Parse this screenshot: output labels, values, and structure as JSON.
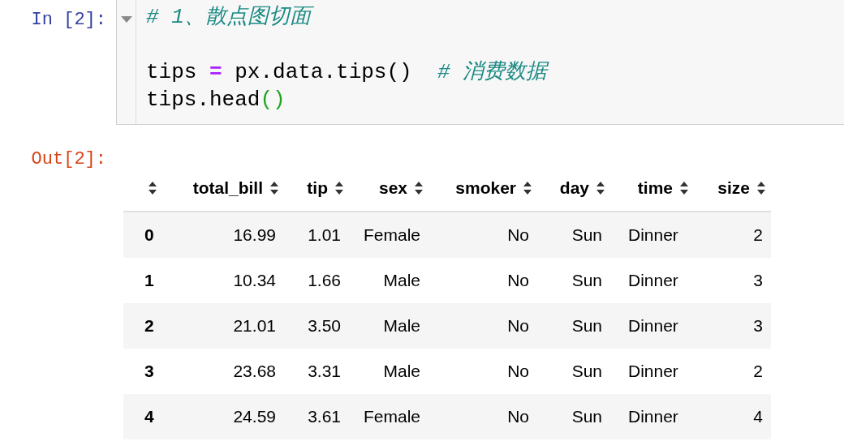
{
  "input_cell": {
    "prompt": "In [2]:",
    "code_lines": [
      {
        "tokens": [
          {
            "text": "# 1、散点图切面",
            "kind": "comment"
          }
        ]
      },
      {
        "tokens": [
          {
            "text": "tips ",
            "kind": "name"
          },
          {
            "text": "=",
            "kind": "operator"
          },
          {
            "text": " px.data.tips()  ",
            "kind": "name"
          },
          {
            "text": "# 消费数据",
            "kind": "comment"
          }
        ]
      },
      {
        "tokens": [
          {
            "text": "tips.head",
            "kind": "name"
          },
          {
            "text": "()",
            "kind": "paren"
          }
        ]
      }
    ]
  },
  "output_cell": {
    "prompt": "Out[2]:",
    "table": {
      "columns": [
        "",
        "total_bill",
        "tip",
        "sex",
        "smoker",
        "day",
        "time",
        "size"
      ],
      "rows": [
        [
          "0",
          "16.99",
          "1.01",
          "Female",
          "No",
          "Sun",
          "Dinner",
          "2"
        ],
        [
          "1",
          "10.34",
          "1.66",
          "Male",
          "No",
          "Sun",
          "Dinner",
          "3"
        ],
        [
          "2",
          "21.01",
          "3.50",
          "Male",
          "No",
          "Sun",
          "Dinner",
          "3"
        ],
        [
          "3",
          "23.68",
          "3.31",
          "Male",
          "No",
          "Sun",
          "Dinner",
          "2"
        ],
        [
          "4",
          "24.59",
          "3.61",
          "Female",
          "No",
          "Sun",
          "Dinner",
          "4"
        ]
      ]
    }
  }
}
